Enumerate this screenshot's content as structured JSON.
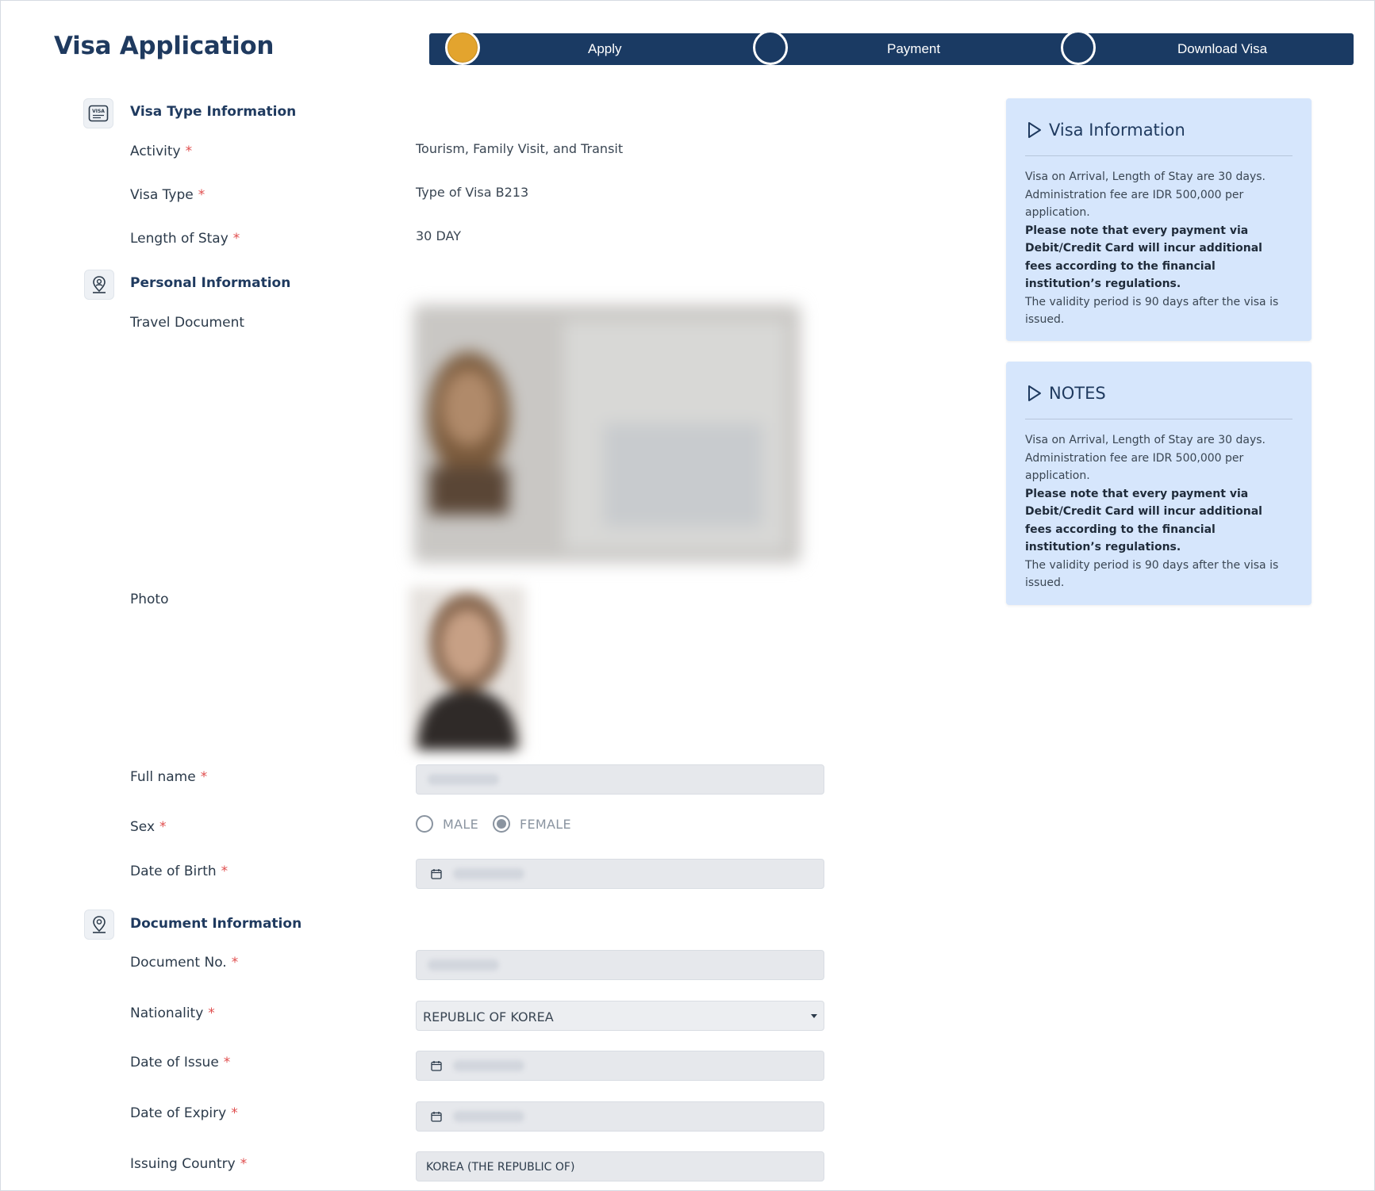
{
  "page": {
    "title": "Visa Application"
  },
  "stepper": {
    "steps": [
      {
        "label": "Apply",
        "active": true
      },
      {
        "label": "Payment",
        "active": false
      },
      {
        "label": "Download Visa",
        "active": false
      }
    ]
  },
  "visa_type": {
    "title": "Visa Type Information",
    "icon": "visa-card-icon",
    "activity_label": "Activity",
    "activity_value": "Tourism, Family Visit, and Transit",
    "visa_type_label": "Visa Type",
    "visa_type_value": "Type of Visa B213",
    "length_label": "Length of Stay",
    "length_value": "30 DAY"
  },
  "personal": {
    "title": "Personal Information",
    "icon": "person-location-icon",
    "travel_document_label": "Travel Document",
    "photo_label": "Photo",
    "full_name_label": "Full name",
    "sex_label": "Sex",
    "sex_options": [
      "MALE",
      "FEMALE"
    ],
    "sex_selected": "FEMALE",
    "dob_label": "Date of Birth"
  },
  "document": {
    "title": "Document Information",
    "icon": "location-pin-icon",
    "doc_no_label": "Document No.",
    "nationality_label": "Nationality",
    "nationality_value": "REPUBLIC OF KOREA",
    "issue_label": "Date of Issue",
    "expiry_label": "Date of Expiry",
    "issuing_country_label": "Issuing Country",
    "issuing_country_value": "KOREA (THE REPUBLIC OF)"
  },
  "required_mark": "*",
  "cards": [
    {
      "title": "Visa Information",
      "line1": "Visa on Arrival, Length of Stay are 30 days. Administration fee are IDR 500,000 per application.",
      "bold": "Please note that every payment via Debit/Credit Card will incur additional fees according to the financial institution’s regulations.",
      "line2": "The validity period is 90 days after the visa is issued."
    },
    {
      "title": "NOTES",
      "line1": "Visa on Arrival, Length of Stay are 30 days. Administration fee are IDR 500,000 per application.",
      "bold": "Please note that every payment via Debit/Credit Card will incur additional fees according to the financial institution’s regulations.",
      "line2": "The validity period is 90 days after the visa is issued."
    }
  ],
  "colors": {
    "brand_navy": "#1a3a63",
    "step_active": "#e3a42e",
    "card_bg": "#d6e6fc",
    "required": "#e04e4e"
  }
}
